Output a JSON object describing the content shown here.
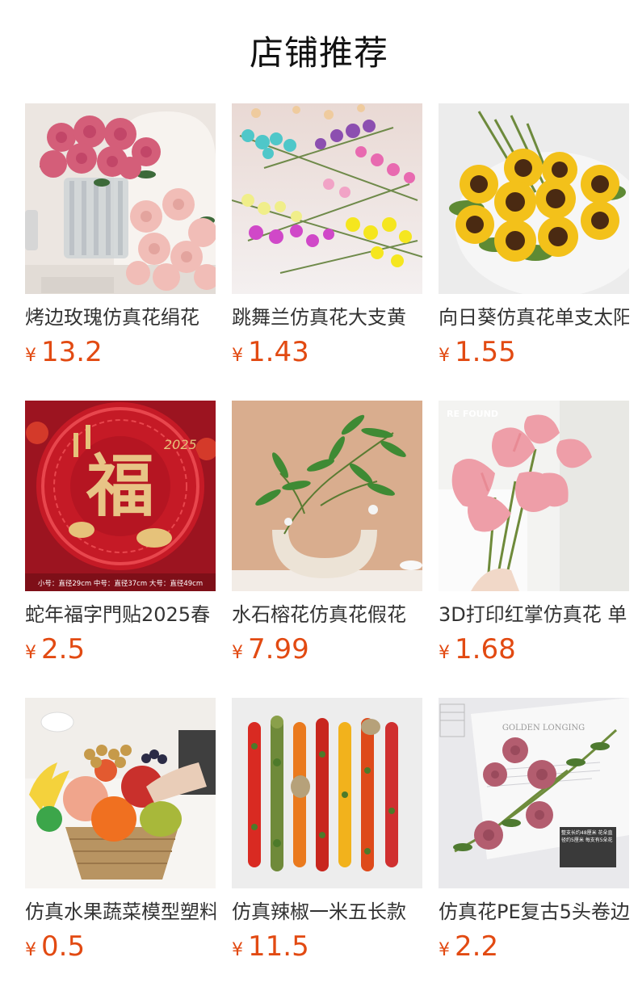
{
  "header": {
    "title": "店铺推荐"
  },
  "products": [
    {
      "title": "烤边玫瑰仿真花绢花",
      "currency": "¥",
      "price": "13.2",
      "image": "pink-roses-vase-image"
    },
    {
      "title": "跳舞兰仿真花大支黄",
      "currency": "¥",
      "price": "1.43",
      "image": "dancing-orchid-image"
    },
    {
      "title": "向日葵仿真花单支太阳",
      "currency": "¥",
      "price": "1.55",
      "image": "sunflower-bouquet-image"
    },
    {
      "title": "蛇年福字門贴2025春",
      "currency": "¥",
      "price": "2.5",
      "image": "fu-door-sticker-image",
      "image_caption": "小号：直径29cm 中号：直径37cm 大号：直径49cm",
      "image_glyph": "福"
    },
    {
      "title": "水石榕花仿真花假花",
      "currency": "¥",
      "price": "7.99",
      "image": "green-branch-vase-image"
    },
    {
      "title": "3D打印红掌仿真花 单",
      "currency": "¥",
      "price": "1.68",
      "image": "pink-anthurium-image",
      "image_logo": "RE FOUND"
    },
    {
      "title": "仿真水果蔬菜模型塑料",
      "currency": "¥",
      "price": "0.5",
      "image": "fruit-basket-image"
    },
    {
      "title": "仿真辣椒一米五长款",
      "currency": "¥",
      "price": "11.5",
      "image": "hanging-peppers-image"
    },
    {
      "title": "仿真花PE复古5头卷边",
      "currency": "¥",
      "price": "2.2",
      "image": "vintage-roses-image",
      "image_text": "GOLDEN LONGING",
      "image_label": "整支长约48厘米 花朵直径约5厘米 每支有5朵花"
    }
  ]
}
